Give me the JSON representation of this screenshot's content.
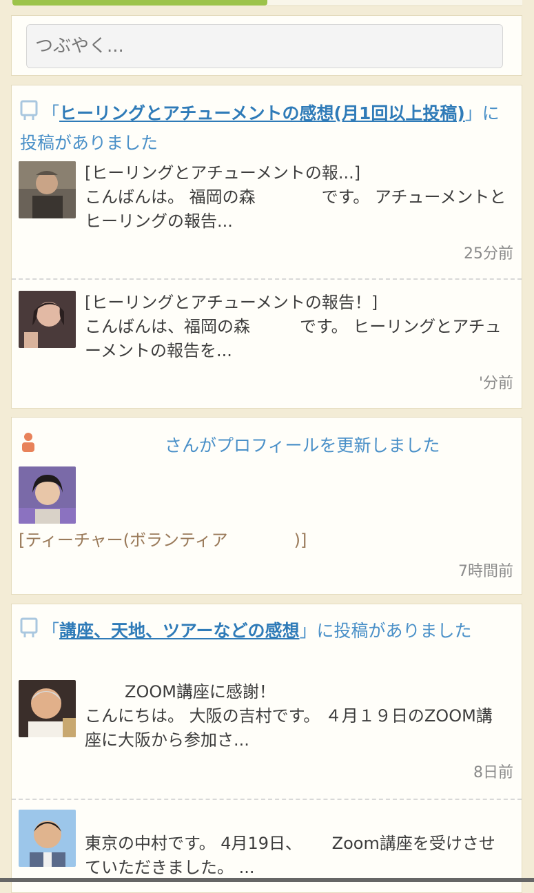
{
  "post_box": {
    "placeholder": "つぶやく..."
  },
  "cards": [
    {
      "type": "thread",
      "prefix": "「",
      "thread_title": "ヒーリングとアチューメントの感想(月1回以上投稿)",
      "suffix": "」に投稿がありました",
      "entries": [
        {
          "title": "[ヒーリングとアチューメントの報...]",
          "body": "こんばんは。 福岡の森　　　　です。 アチューメントとヒーリングの報告...",
          "time": "25分前"
        },
        {
          "title": "[ヒーリングとアチューメントの報告！]",
          "body": "こんばんは、福岡の森　　　です。 ヒーリングとアチューメントの報告を...",
          "time": "'分前"
        }
      ]
    },
    {
      "type": "profile",
      "headline": "さんがプロフィールを更新しました",
      "tag": "[ティーチャー(ボランティア　　　　)]",
      "time": "7時間前"
    },
    {
      "type": "thread",
      "prefix": "「",
      "thread_title": "講座、天地、ツアーなどの感想",
      "suffix": "」に投稿がありました",
      "entries": [
        {
          "title": "ZOOM講座に感謝！",
          "body": "こんにちは。 大阪の吉村です。 ４月１９日のZOOM講座に大阪から参加さ...",
          "time": "8日前"
        },
        {
          "title": "",
          "body": "東京の中村です。 4月19日、　　 Zoom講座を受けさせていただきました。 ...",
          "time": ""
        }
      ]
    }
  ],
  "colors": {
    "accent": "#2f7bb8",
    "highlight_green": "#9cc34a",
    "profile_icon": "#e8825a",
    "background": "#f3ecd6"
  }
}
